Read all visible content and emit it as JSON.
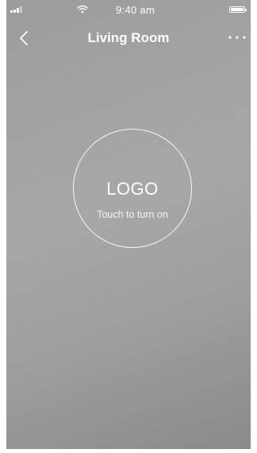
{
  "status_bar": {
    "time": "9:40 am",
    "signal_bars": 4,
    "battery_level": 1.0
  },
  "nav": {
    "title": "Living Room",
    "back_icon": "chevron-left-icon",
    "more_icon": "more-horizontal-icon"
  },
  "main": {
    "logo_text": "LOGO",
    "hint": "Touch to turn on"
  },
  "colors": {
    "background": "#a3a3a3",
    "foreground": "#ffffff"
  }
}
